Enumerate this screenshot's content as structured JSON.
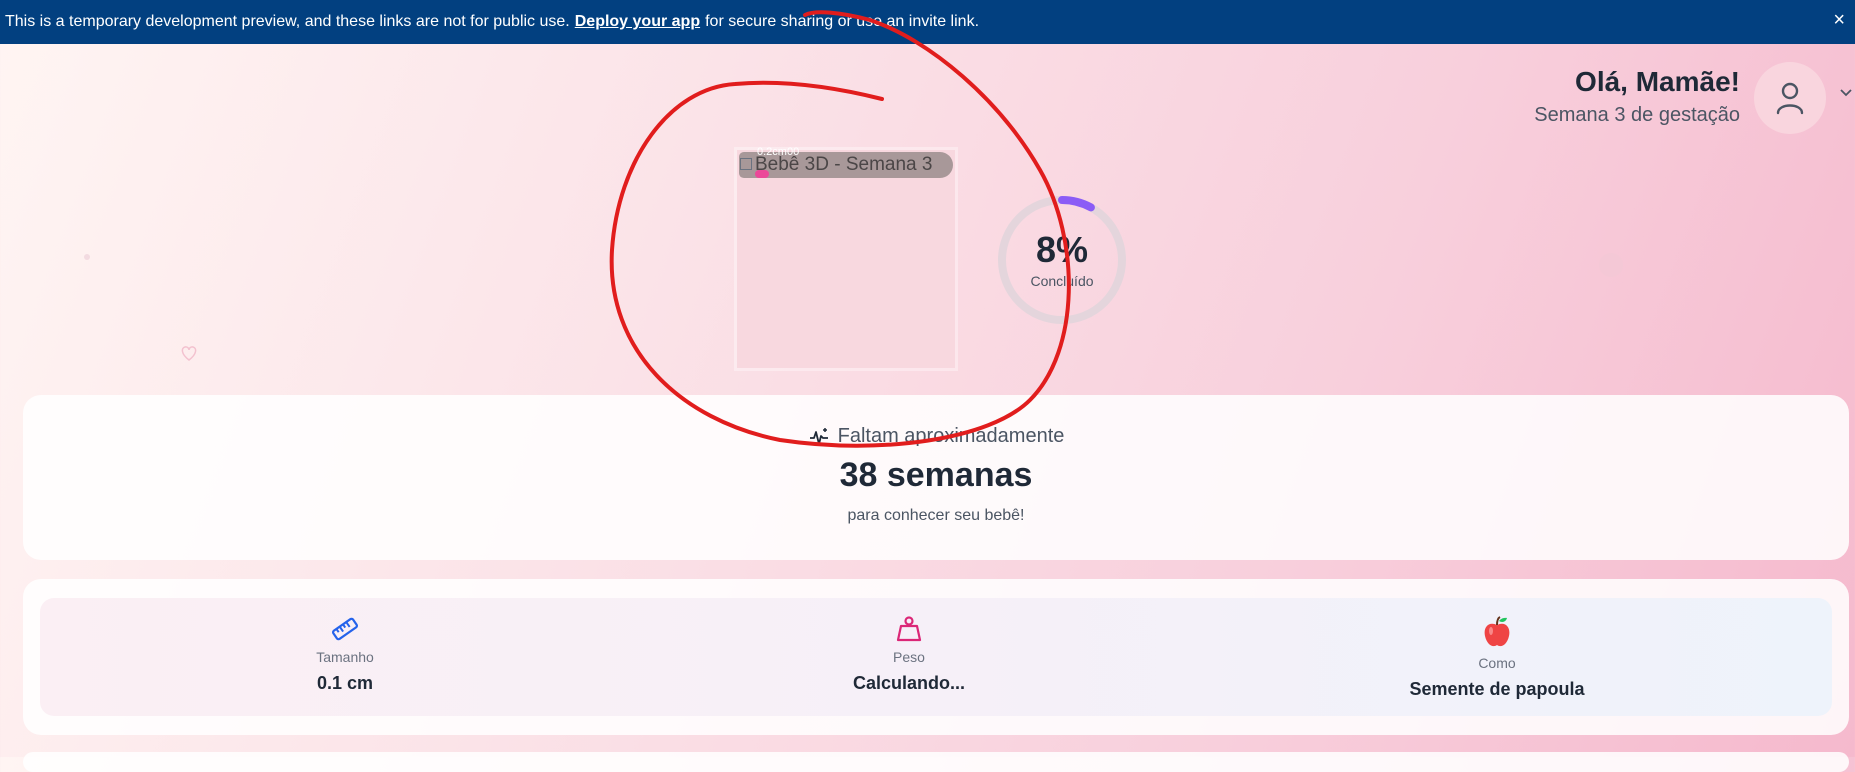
{
  "banner": {
    "text_before": "This is a temporary development preview, and these links are not for public use.",
    "link": "Deploy your app",
    "text_after": "for secure sharing or use an invite link.",
    "close": "×",
    "color": "#024080"
  },
  "header": {
    "greeting": "Olá, Mamãe!",
    "week": "Semana 3 de gestação",
    "avatar_icon": "user-icon",
    "dropdown_icon": "chevron-down-icon"
  },
  "baby_model": {
    "alt_text": "Bebê 3D - Semana 3",
    "size_label": "0.2cm00"
  },
  "progress": {
    "percent_label": "8%",
    "percent_value": 8,
    "caption": "Concluído",
    "ring_color": "#8b5cf6"
  },
  "countdown": {
    "icon": "sparkles-icon",
    "intro": "Faltam aproximadamente",
    "weeks": "38 semanas",
    "outro": "para conhecer seu bebê!"
  },
  "stats": [
    {
      "icon": "ruler-icon",
      "label": "Tamanho",
      "value": "0.1 cm"
    },
    {
      "icon": "weight-icon",
      "label": "Peso",
      "value": "Calculando..."
    },
    {
      "icon": "apple-icon",
      "label": "Como",
      "value": "Semente de papoula"
    }
  ],
  "annotation_color": "#e11d1d"
}
